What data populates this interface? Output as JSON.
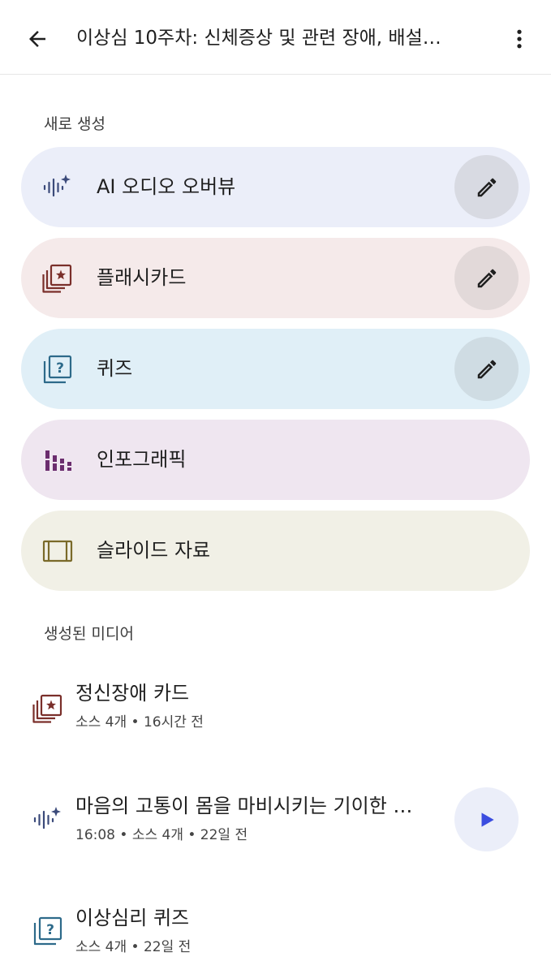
{
  "header": {
    "title": "이상심 10주차: 신체증상 및 관련 장애, 배설…",
    "back_icon": "arrow-left-icon",
    "more_icon": "more-vertical-icon"
  },
  "create_section": {
    "label": "새로 생성",
    "items": [
      {
        "label": "AI 오디오 오버뷰",
        "icon": "audio-sparkle-icon",
        "bg": "#ebeef9",
        "accent": "#3b4a7a",
        "edit_bg": "#d8dae2",
        "has_edit": true
      },
      {
        "label": "플래시카드",
        "icon": "flashcard-star-icon",
        "bg": "#f5eaea",
        "accent": "#7a2f2a",
        "edit_bg": "#e2d9d9",
        "has_edit": true
      },
      {
        "label": "퀴즈",
        "icon": "quiz-question-icon",
        "bg": "#e0eff7",
        "accent": "#2d6a8a",
        "edit_bg": "#cfdce3",
        "has_edit": true
      },
      {
        "label": "인포그래픽",
        "icon": "infographic-bars-icon",
        "bg": "#efe6f0",
        "accent": "#6b2d6e",
        "has_edit": false
      },
      {
        "label": "슬라이드 자료",
        "icon": "slides-icon",
        "bg": "#f1f0e6",
        "accent": "#7a6a2a",
        "has_edit": false
      }
    ]
  },
  "media_section": {
    "label": "생성된 미디어",
    "items": [
      {
        "title": "정신장애 카드",
        "subtitle": "소스 4개 • 16시간 전",
        "icon": "flashcard-star-icon",
        "accent": "#7a2f2a"
      },
      {
        "title": "마음의 고통이 몸을 마비시키는 기이한 …",
        "subtitle": "16:08 • 소스 4개 • 22일 전",
        "icon": "audio-sparkle-icon",
        "accent": "#3b4a7a",
        "play_icon": "play-icon",
        "play_bg": "#ebeef9",
        "play_color": "#3b4de0"
      },
      {
        "title": "이상심리 퀴즈",
        "subtitle": "소스 4개 • 22일 전",
        "icon": "quiz-question-icon",
        "accent": "#2d6a8a"
      }
    ]
  }
}
